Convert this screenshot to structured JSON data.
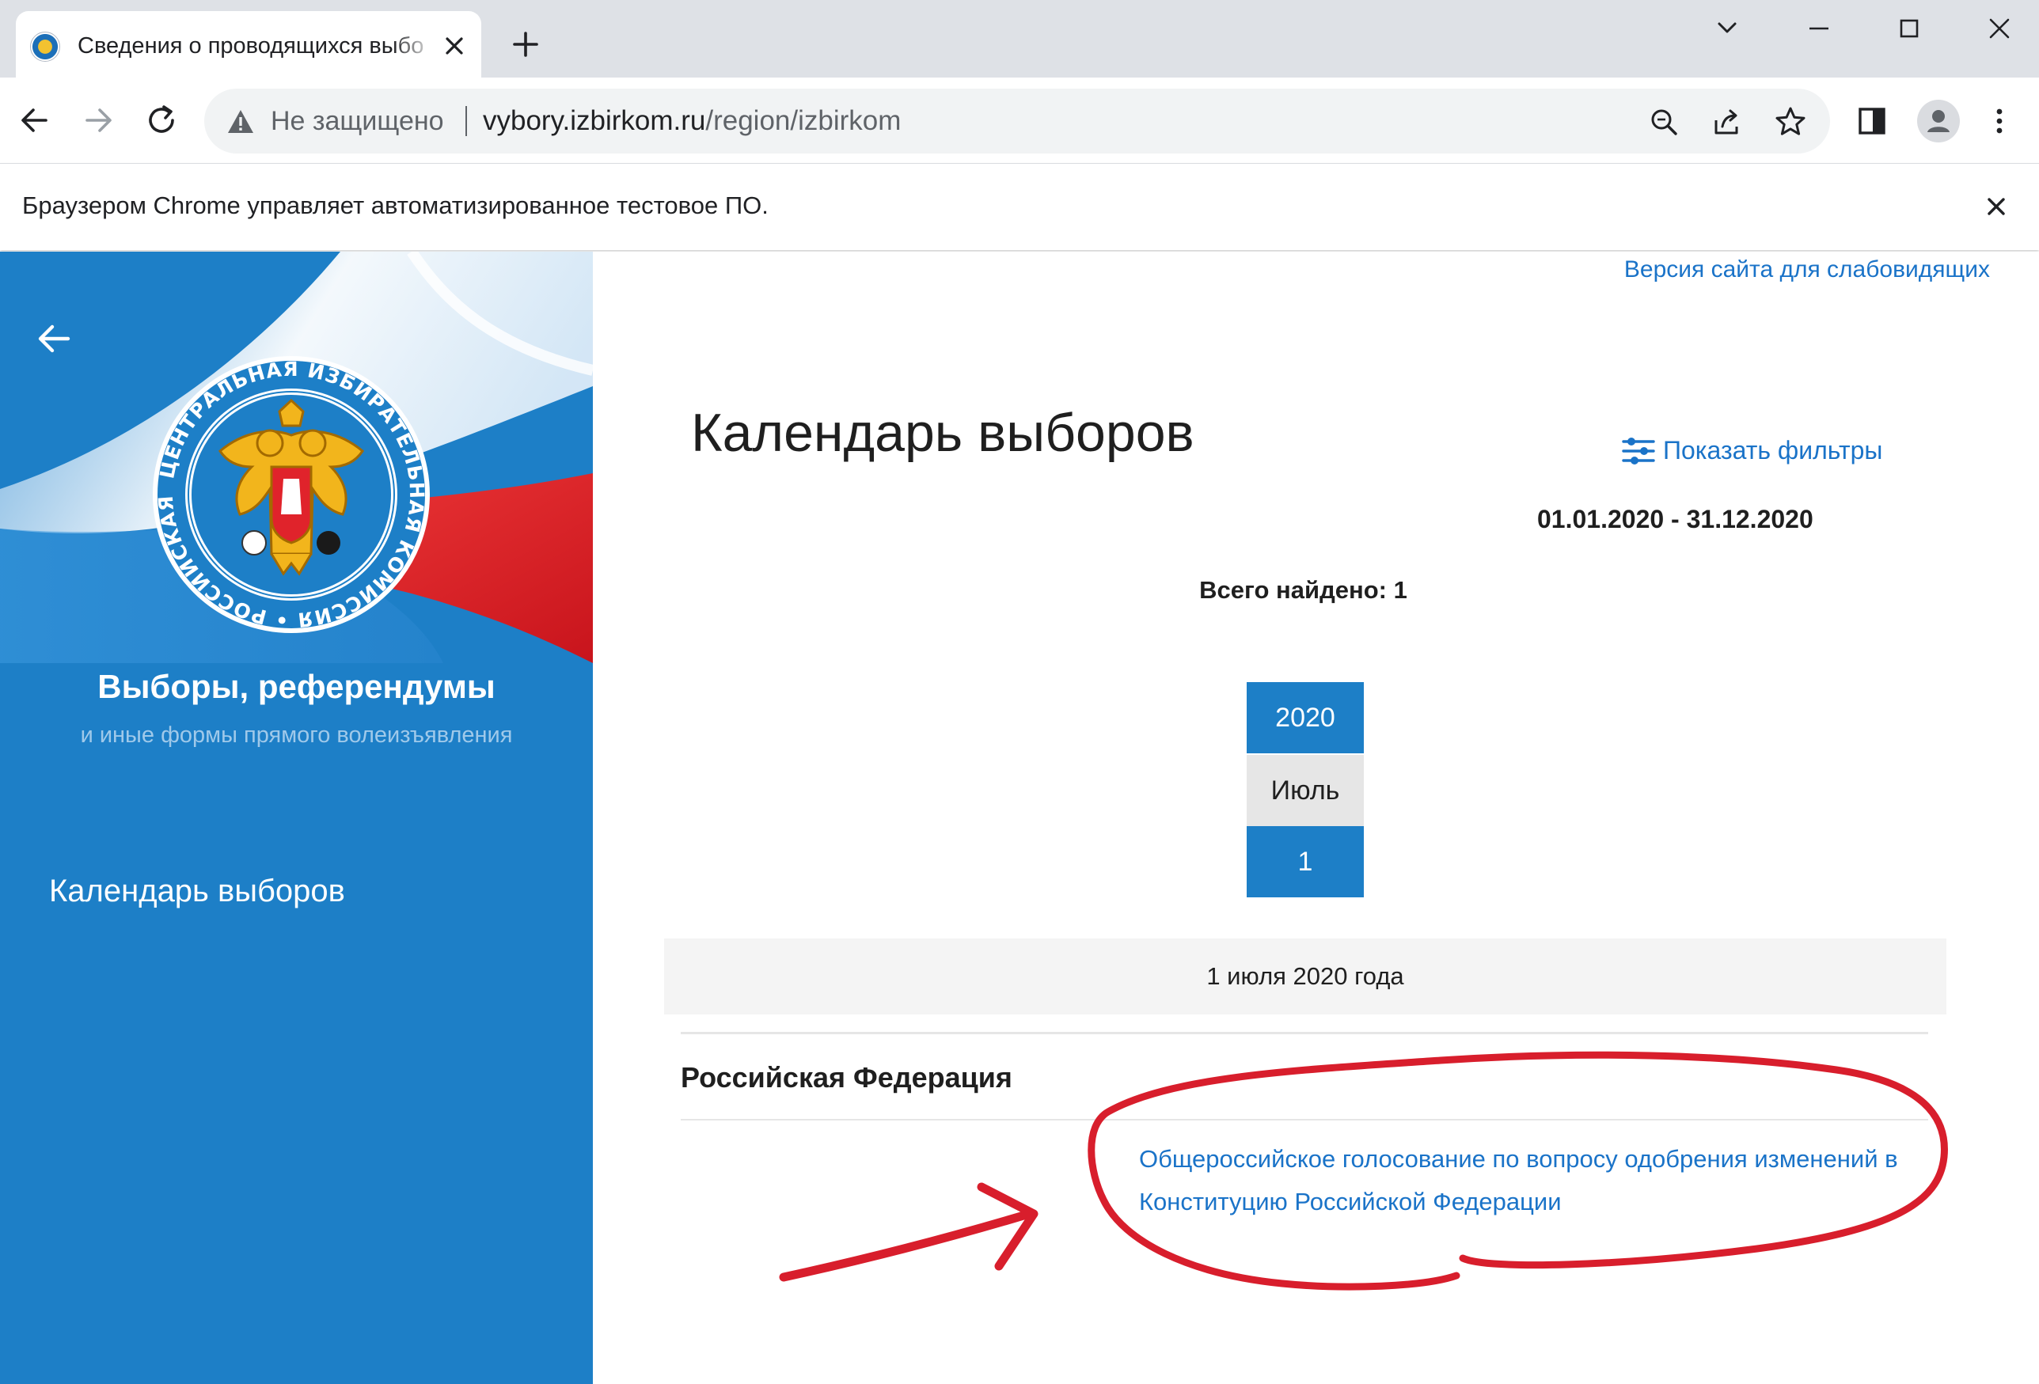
{
  "browser": {
    "tab": {
      "title": "Сведения о проводящихся выбо",
      "favicon": "cik-emblem-icon"
    },
    "omnibox": {
      "security_label": "Не защищено",
      "url_host": "vybory.izbirkom.ru",
      "url_path": "/region/izbirkom"
    },
    "infobar": {
      "text": "Браузером Chrome управляет автоматизированное тестовое ПО."
    }
  },
  "sidebar": {
    "title": "Выборы, референдумы",
    "subtitle": "и иные формы прямого волеизъявления",
    "nav_item": "Календарь выборов",
    "emblem_ring_text": "ЦЕНТРАЛЬНАЯ ИЗБИРАТЕЛЬНАЯ КОМИССИЯ • РОССИЙСКАЯ ФЕДЕРАЦИЯ"
  },
  "content": {
    "a11y_link": "Версия сайта для слабовидящих",
    "page_title": "Календарь выборов",
    "filters_label": "Показать фильтры",
    "date_range": "01.01.2020 - 31.12.2020",
    "total_found": "Всего найдено: 1",
    "calendar": {
      "year": "2020",
      "month": "Июль",
      "day": "1"
    },
    "date_header": "1 июля 2020 года",
    "region": "Российская Федерация",
    "election_link": "Общероссийское голосование по вопросу одобрения изменений в Конституцию Российской Федерации"
  },
  "colors": {
    "sidebar_blue": "#1d7fc7",
    "link_blue": "#1a73c8",
    "annotation_red": "#d81e2c"
  }
}
